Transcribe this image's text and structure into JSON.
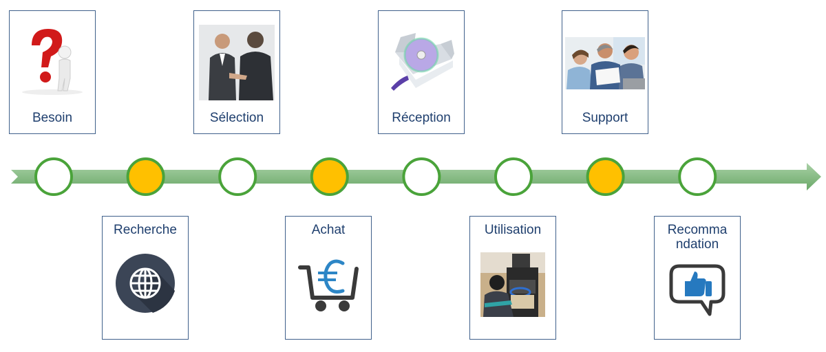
{
  "diagram": {
    "type": "customer-journey-timeline",
    "colors": {
      "arrow": "#8dc08a",
      "arrow_dark": "#6aa868",
      "node_border": "#4aa33a",
      "node_empty": "#ffffff",
      "node_highlight": "#ffc000",
      "card_border": "#3e5f8a",
      "label_text": "#1f3f6e"
    },
    "stages": [
      {
        "label": "Besoin",
        "position": "top",
        "highlighted": false,
        "icon": "question-mark-person-icon"
      },
      {
        "label": "Recherche",
        "position": "bottom",
        "highlighted": true,
        "icon": "globe-icon"
      },
      {
        "label": "Sélection",
        "position": "top",
        "highlighted": false,
        "icon": "handshake-photo"
      },
      {
        "label": "Achat",
        "position": "bottom",
        "highlighted": true,
        "icon": "cart-euro-icon"
      },
      {
        "label": "Réception",
        "position": "top",
        "highlighted": false,
        "icon": "cd-box-icon"
      },
      {
        "label": "Utilisation",
        "position": "bottom",
        "highlighted": false,
        "icon": "workstation-photo"
      },
      {
        "label": "Support",
        "position": "top",
        "highlighted": true,
        "icon": "team-photo"
      },
      {
        "label": "Recomma\nndation",
        "position": "bottom",
        "highlighted": false,
        "icon": "thumbs-up-bubble-icon"
      }
    ]
  }
}
